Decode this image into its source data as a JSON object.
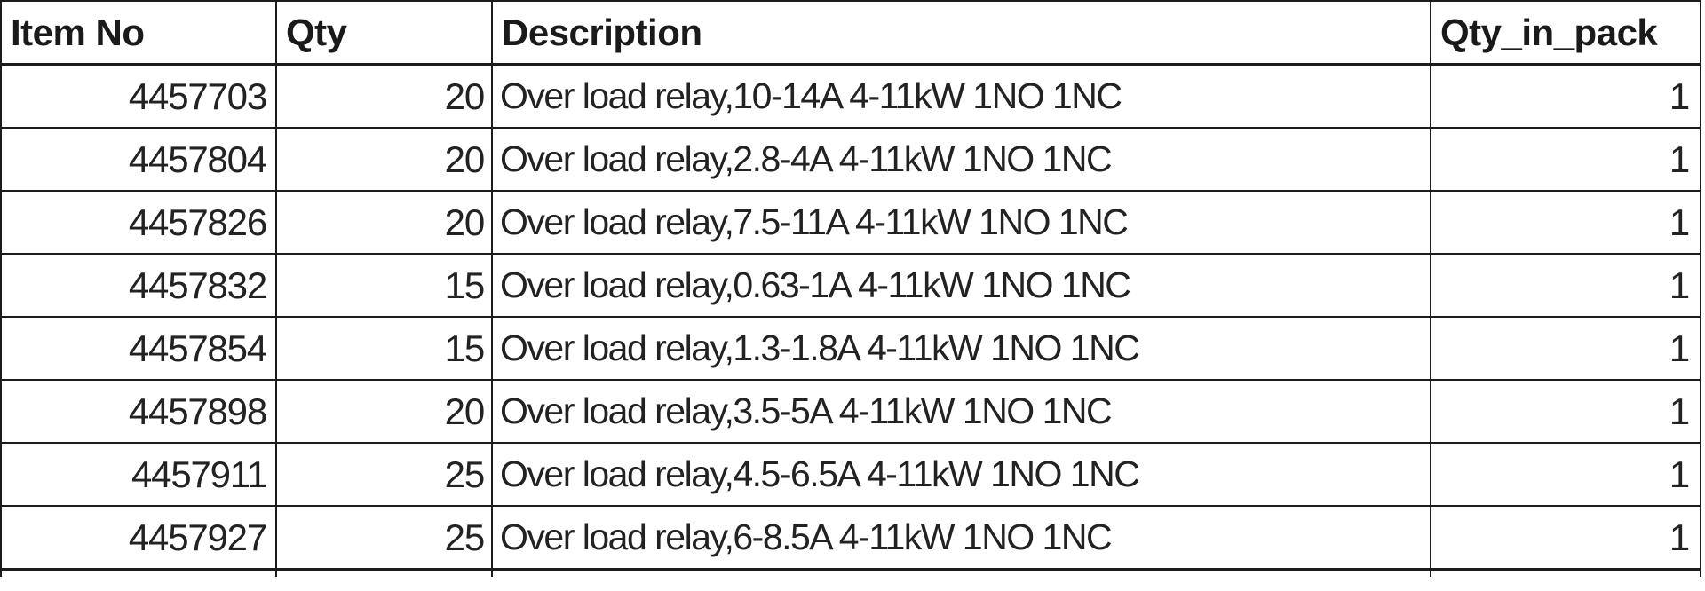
{
  "table": {
    "columns": [
      {
        "key": "item_no",
        "label": "Item No"
      },
      {
        "key": "qty",
        "label": "Qty"
      },
      {
        "key": "description",
        "label": "Description"
      },
      {
        "key": "qty_in_pack",
        "label": "Qty_in_pack"
      }
    ],
    "rows": [
      {
        "item_no": "4457703",
        "qty": "20",
        "description": "Over load relay,10-14A 4-11kW 1NO 1NC",
        "qty_in_pack": "1"
      },
      {
        "item_no": "4457804",
        "qty": "20",
        "description": "Over load relay,2.8-4A 4-11kW 1NO 1NC",
        "qty_in_pack": "1"
      },
      {
        "item_no": "4457826",
        "qty": "20",
        "description": "Over load relay,7.5-11A 4-11kW 1NO 1NC",
        "qty_in_pack": "1"
      },
      {
        "item_no": "4457832",
        "qty": "15",
        "description": "Over load relay,0.63-1A 4-11kW 1NO 1NC",
        "qty_in_pack": "1"
      },
      {
        "item_no": "4457854",
        "qty": "15",
        "description": "Over load relay,1.3-1.8A 4-11kW 1NO 1NC",
        "qty_in_pack": "1"
      },
      {
        "item_no": "4457898",
        "qty": "20",
        "description": "Over load relay,3.5-5A 4-11kW 1NO 1NC",
        "qty_in_pack": "1"
      },
      {
        "item_no": "4457911",
        "qty": "25",
        "description": "Over load relay,4.5-6.5A 4-11kW 1NO 1NC",
        "qty_in_pack": "1"
      },
      {
        "item_no": "4457927",
        "qty": "25",
        "description": "Over load relay,6-8.5A 4-11kW 1NO 1NC",
        "qty_in_pack": "1"
      }
    ]
  }
}
